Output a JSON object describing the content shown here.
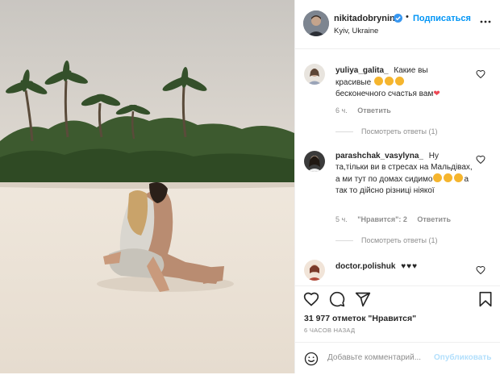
{
  "header": {
    "username": "nikitadobrynin",
    "dot": "•",
    "follow_label": "Подписаться",
    "location": "Kyiv, Ukraine"
  },
  "comments": [
    {
      "username": "yuliya_galita_",
      "text_1": "Какие вы",
      "text_2": "красивые",
      "text_3": "бесконечного счастья вам",
      "time": "6 ч.",
      "reply_label": "Ответить",
      "view_replies": "Посмотреть ответы (1)"
    },
    {
      "username": "parashchak_vasylyna_",
      "text_1": "Ну та,тільки ви в стресах на Мальдівах, а ми тут по домах сидимо",
      "text_2": "а так то дійсно різниці ніякої",
      "time": "5 ч.",
      "likes_label": "\"Нравится\": 2",
      "reply_label": "Ответить",
      "view_replies": "Посмотреть ответы (1)"
    },
    {
      "username": "doctor.polishuk",
      "hearts": "♥♥♥"
    }
  ],
  "footer": {
    "likes_count": "31 977 отметок \"Нравится\"",
    "time_ago": "6 ЧАСОВ НАЗАД",
    "comment_placeholder": "Добавьте комментарий...",
    "publish_label": "Опубликовать"
  },
  "colors": {
    "accent": "#0095f6",
    "verified": "#3897f0",
    "heart_red": "#ed4956"
  },
  "icons": [
    "heart-icon",
    "comment-icon",
    "share-icon",
    "bookmark-icon",
    "emoji-icon",
    "more-options-icon",
    "verified-badge-icon"
  ]
}
